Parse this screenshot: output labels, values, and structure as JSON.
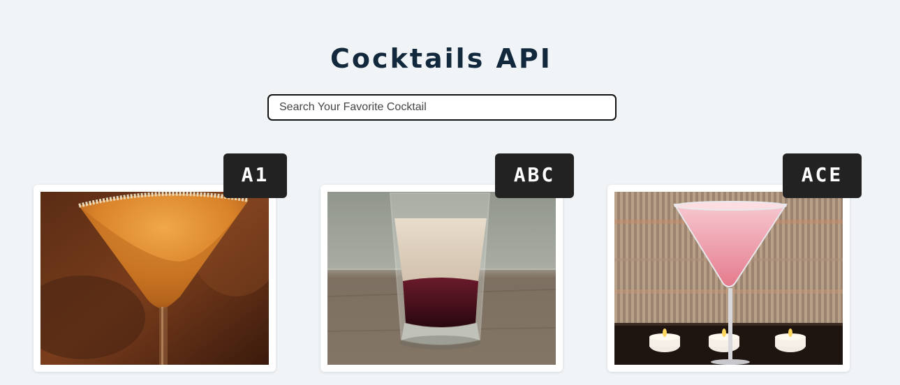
{
  "header": {
    "title": "Cocktails API"
  },
  "search": {
    "placeholder": "Search Your Favorite Cocktail",
    "value": ""
  },
  "drinks": [
    {
      "name": "A1",
      "image": "orange martini with sugared rim"
    },
    {
      "name": "ABC",
      "image": "layered shot glass"
    },
    {
      "name": "ACE",
      "image": "pink martini with candles"
    }
  ]
}
